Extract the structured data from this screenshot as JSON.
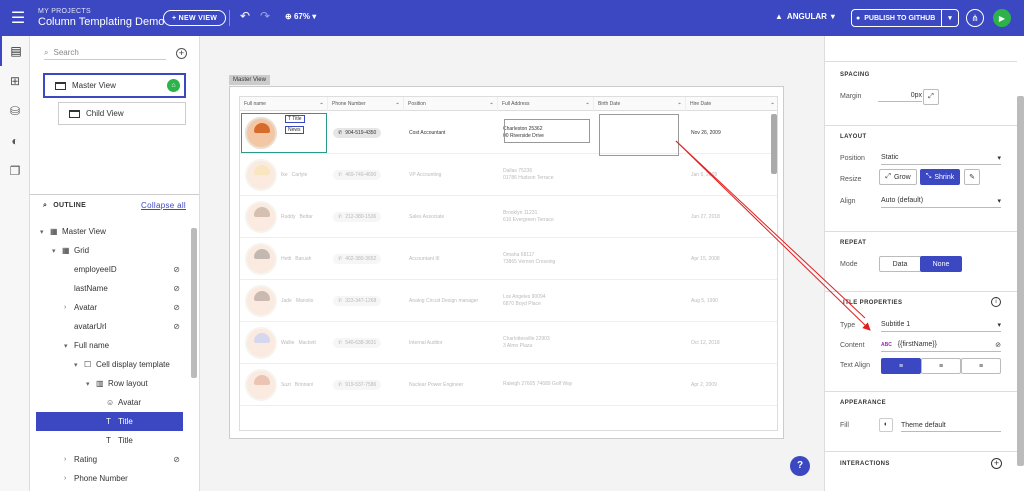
{
  "header": {
    "project_label": "MY PROJECTS",
    "project_name": "Column Templating Demo",
    "new_view": "+ NEW VIEW",
    "zoom": "67%",
    "framework": "ANGULAR",
    "publish": "PUBLISH TO GITHUB"
  },
  "views": {
    "search_placeholder": "Search",
    "master": "Master View",
    "child": "Child View"
  },
  "outline": {
    "title": "OUTLINE",
    "collapse": "Collapse all",
    "items": [
      {
        "label": "Master View"
      },
      {
        "label": "Grid"
      },
      {
        "label": "employeeID"
      },
      {
        "label": "lastName"
      },
      {
        "label": "Avatar"
      },
      {
        "label": "avatarUrl"
      },
      {
        "label": "Full name"
      },
      {
        "label": "Cell display template"
      },
      {
        "label": "Row layout"
      },
      {
        "label": "Avatar"
      },
      {
        "label": "Title"
      },
      {
        "label": "Title"
      },
      {
        "label": "Rating"
      },
      {
        "label": "Phone Number"
      }
    ]
  },
  "canvas": {
    "tag": "Master View",
    "columns": [
      "Full name",
      "Phone Number",
      "Position",
      "Full Address",
      "Birth Date",
      "Hire Date"
    ],
    "selected_labels": {
      "title": "Title",
      "news": "News"
    },
    "rows": [
      {
        "first": "",
        "last": "",
        "phone": "904-519-4350",
        "position": "Cost Accountant",
        "addr1": "Charleston 25362",
        "addr2": "00 Riverside Drive",
        "hire": "Nov 26, 2009",
        "hair": "#d86b2c"
      },
      {
        "first": "Ike",
        "last": "Carlyle",
        "phone": "469-749-4690",
        "position": "VP Accounting",
        "addr1": "Dallas 75236",
        "addr2": "01786 Hudson Terrace",
        "hire": "Jan 6, 2009",
        "hair": "#e9b84a"
      },
      {
        "first": "Ruddy",
        "last": "Bettar",
        "phone": "212-380-1536",
        "position": "Sales Associate",
        "addr1": "Brooklyn 11231",
        "addr2": "610 Evergreen Terrace",
        "hire": "Jun 27, 2018",
        "hair": "#8a4a20"
      },
      {
        "first": "Hetti",
        "last": "Baruah",
        "phone": "402-380-3652",
        "position": "Accountant III",
        "addr1": "Omaha 68117",
        "addr2": "73865 Vernon Crossing",
        "hire": "Apr 15, 2008",
        "hair": "#5a3a22"
      },
      {
        "first": "Jade",
        "last": "Manolio",
        "phone": "323-347-1268",
        "position": "Analog Circuit Design manager",
        "addr1": "Los Angeles 90094",
        "addr2": "6870 Boyd Place",
        "hire": "Aug 5, 1990",
        "hair": "#6b3b25"
      },
      {
        "first": "Wallie",
        "last": "Mackett",
        "phone": "540-638-3631",
        "position": "Internal Auditor",
        "addr1": "Charlottesville 22903",
        "addr2": "3 Almo Plaza",
        "hire": "Oct 12, 2018",
        "hair": "#8a8fd0"
      },
      {
        "first": "Suzi",
        "last": "Brinnani",
        "phone": "919-537-7586",
        "position": "Nuclear Power Engineer",
        "addr1": "Raleigh 27605 74689 Golf Way",
        "addr2": "",
        "hire": "Apr 2, 2009",
        "hair": "#c9582a"
      }
    ]
  },
  "props": {
    "spacing_title": "SPACING",
    "margin_label": "Margin",
    "margin_value": "0px",
    "layout_title": "LAYOUT",
    "position_label": "Position",
    "position_value": "Static",
    "resize_label": "Resize",
    "grow": "Grow",
    "shrink": "Shrink",
    "align_label": "Align",
    "align_value": "Auto (default)",
    "repeat_title": "REPEAT",
    "mode_label": "Mode",
    "mode_data": "Data",
    "mode_none": "None",
    "title_props": "ITLE PROPERTIES",
    "type_label": "Type",
    "type_value": "Subtitle 1",
    "content_label": "Content",
    "content_badge": "ABC",
    "content_value": "{{firstName}}",
    "textalign_label": "Text Align",
    "appearance_title": "APPEARANCE",
    "fill_label": "Fill",
    "fill_value": "Theme default",
    "interactions_title": "INTERACTIONS"
  },
  "colors": {
    "accent": "#3b48c1",
    "success": "#2db34a",
    "annotation": "#e02020"
  }
}
